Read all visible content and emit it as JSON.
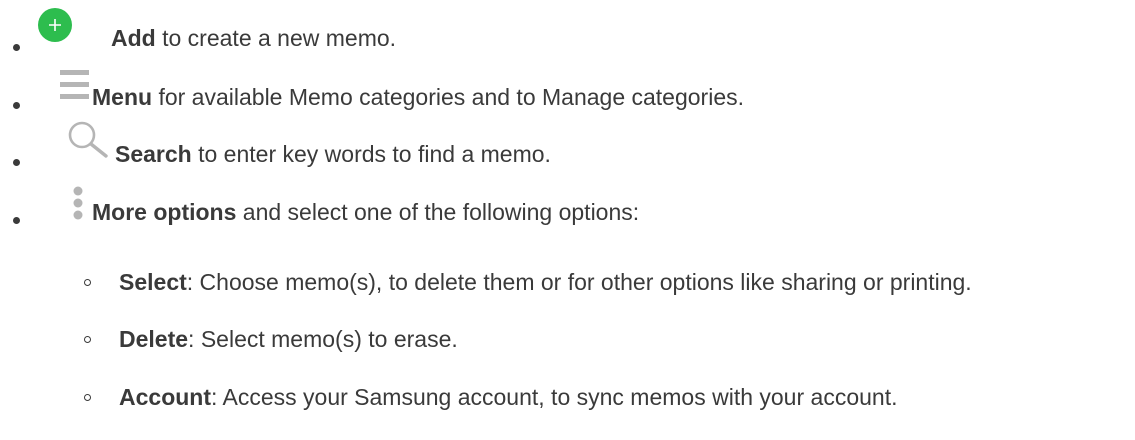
{
  "items": [
    {
      "icon": "add-icon",
      "bold": "Add",
      "rest": " to create a new memo."
    },
    {
      "icon": "menu-icon",
      "bold": "Menu",
      "rest": " for available Memo categories and to Manage categories."
    },
    {
      "icon": "search-icon",
      "bold": "Search",
      "rest": " to enter key words to find a memo."
    },
    {
      "icon": "more-options-icon",
      "bold": "More options",
      "rest": " and select one of the following options:"
    }
  ],
  "subitems": [
    {
      "bold": "Select",
      "rest": ": Choose memo(s), to delete them or for other options like sharing or printing."
    },
    {
      "bold": "Delete",
      "rest": ": Select memo(s) to erase."
    },
    {
      "bold": "Account",
      "rest": ": Access your Samsung account, to sync memos with your account."
    }
  ],
  "colors": {
    "text": "#3a3a3a",
    "add_icon_green": "#2dbd4e",
    "icon_gray": "#b5b5b5"
  }
}
